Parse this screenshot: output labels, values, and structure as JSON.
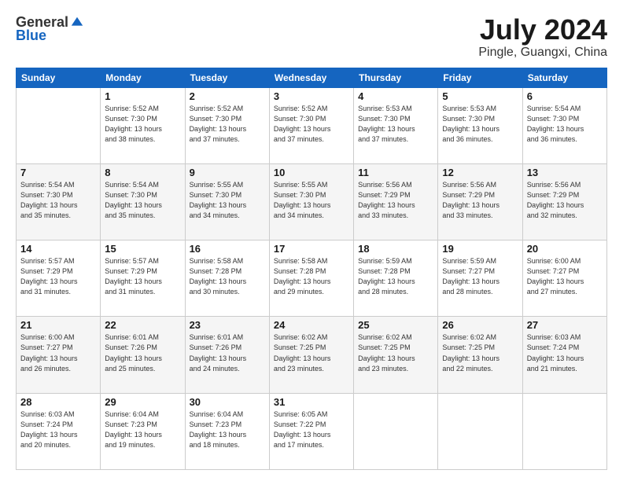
{
  "logo": {
    "general": "General",
    "blue": "Blue"
  },
  "title": "July 2024",
  "subtitle": "Pingle, Guangxi, China",
  "weekdays": [
    "Sunday",
    "Monday",
    "Tuesday",
    "Wednesday",
    "Thursday",
    "Friday",
    "Saturday"
  ],
  "weeks": [
    [
      {
        "day": "",
        "info": ""
      },
      {
        "day": "1",
        "info": "Sunrise: 5:52 AM\nSunset: 7:30 PM\nDaylight: 13 hours\nand 38 minutes."
      },
      {
        "day": "2",
        "info": "Sunrise: 5:52 AM\nSunset: 7:30 PM\nDaylight: 13 hours\nand 37 minutes."
      },
      {
        "day": "3",
        "info": "Sunrise: 5:52 AM\nSunset: 7:30 PM\nDaylight: 13 hours\nand 37 minutes."
      },
      {
        "day": "4",
        "info": "Sunrise: 5:53 AM\nSunset: 7:30 PM\nDaylight: 13 hours\nand 37 minutes."
      },
      {
        "day": "5",
        "info": "Sunrise: 5:53 AM\nSunset: 7:30 PM\nDaylight: 13 hours\nand 36 minutes."
      },
      {
        "day": "6",
        "info": "Sunrise: 5:54 AM\nSunset: 7:30 PM\nDaylight: 13 hours\nand 36 minutes."
      }
    ],
    [
      {
        "day": "7",
        "info": "Sunrise: 5:54 AM\nSunset: 7:30 PM\nDaylight: 13 hours\nand 35 minutes."
      },
      {
        "day": "8",
        "info": "Sunrise: 5:54 AM\nSunset: 7:30 PM\nDaylight: 13 hours\nand 35 minutes."
      },
      {
        "day": "9",
        "info": "Sunrise: 5:55 AM\nSunset: 7:30 PM\nDaylight: 13 hours\nand 34 minutes."
      },
      {
        "day": "10",
        "info": "Sunrise: 5:55 AM\nSunset: 7:30 PM\nDaylight: 13 hours\nand 34 minutes."
      },
      {
        "day": "11",
        "info": "Sunrise: 5:56 AM\nSunset: 7:29 PM\nDaylight: 13 hours\nand 33 minutes."
      },
      {
        "day": "12",
        "info": "Sunrise: 5:56 AM\nSunset: 7:29 PM\nDaylight: 13 hours\nand 33 minutes."
      },
      {
        "day": "13",
        "info": "Sunrise: 5:56 AM\nSunset: 7:29 PM\nDaylight: 13 hours\nand 32 minutes."
      }
    ],
    [
      {
        "day": "14",
        "info": "Sunrise: 5:57 AM\nSunset: 7:29 PM\nDaylight: 13 hours\nand 31 minutes."
      },
      {
        "day": "15",
        "info": "Sunrise: 5:57 AM\nSunset: 7:29 PM\nDaylight: 13 hours\nand 31 minutes."
      },
      {
        "day": "16",
        "info": "Sunrise: 5:58 AM\nSunset: 7:28 PM\nDaylight: 13 hours\nand 30 minutes."
      },
      {
        "day": "17",
        "info": "Sunrise: 5:58 AM\nSunset: 7:28 PM\nDaylight: 13 hours\nand 29 minutes."
      },
      {
        "day": "18",
        "info": "Sunrise: 5:59 AM\nSunset: 7:28 PM\nDaylight: 13 hours\nand 28 minutes."
      },
      {
        "day": "19",
        "info": "Sunrise: 5:59 AM\nSunset: 7:27 PM\nDaylight: 13 hours\nand 28 minutes."
      },
      {
        "day": "20",
        "info": "Sunrise: 6:00 AM\nSunset: 7:27 PM\nDaylight: 13 hours\nand 27 minutes."
      }
    ],
    [
      {
        "day": "21",
        "info": "Sunrise: 6:00 AM\nSunset: 7:27 PM\nDaylight: 13 hours\nand 26 minutes."
      },
      {
        "day": "22",
        "info": "Sunrise: 6:01 AM\nSunset: 7:26 PM\nDaylight: 13 hours\nand 25 minutes."
      },
      {
        "day": "23",
        "info": "Sunrise: 6:01 AM\nSunset: 7:26 PM\nDaylight: 13 hours\nand 24 minutes."
      },
      {
        "day": "24",
        "info": "Sunrise: 6:02 AM\nSunset: 7:25 PM\nDaylight: 13 hours\nand 23 minutes."
      },
      {
        "day": "25",
        "info": "Sunrise: 6:02 AM\nSunset: 7:25 PM\nDaylight: 13 hours\nand 23 minutes."
      },
      {
        "day": "26",
        "info": "Sunrise: 6:02 AM\nSunset: 7:25 PM\nDaylight: 13 hours\nand 22 minutes."
      },
      {
        "day": "27",
        "info": "Sunrise: 6:03 AM\nSunset: 7:24 PM\nDaylight: 13 hours\nand 21 minutes."
      }
    ],
    [
      {
        "day": "28",
        "info": "Sunrise: 6:03 AM\nSunset: 7:24 PM\nDaylight: 13 hours\nand 20 minutes."
      },
      {
        "day": "29",
        "info": "Sunrise: 6:04 AM\nSunset: 7:23 PM\nDaylight: 13 hours\nand 19 minutes."
      },
      {
        "day": "30",
        "info": "Sunrise: 6:04 AM\nSunset: 7:23 PM\nDaylight: 13 hours\nand 18 minutes."
      },
      {
        "day": "31",
        "info": "Sunrise: 6:05 AM\nSunset: 7:22 PM\nDaylight: 13 hours\nand 17 minutes."
      },
      {
        "day": "",
        "info": ""
      },
      {
        "day": "",
        "info": ""
      },
      {
        "day": "",
        "info": ""
      }
    ]
  ]
}
